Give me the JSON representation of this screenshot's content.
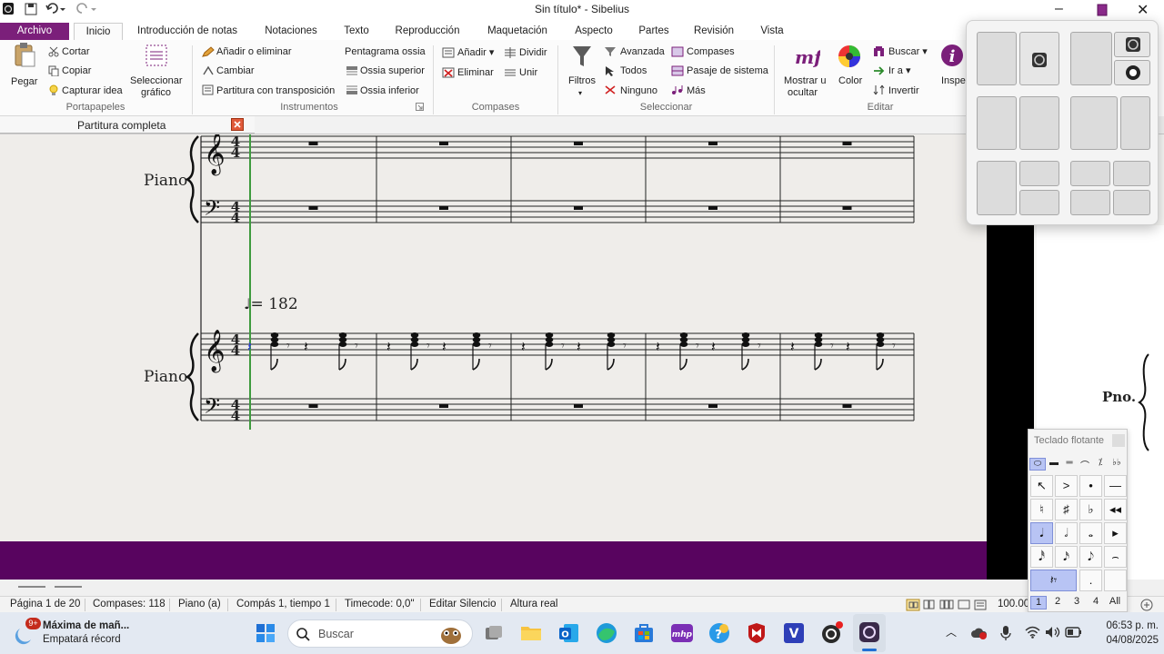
{
  "window": {
    "title": "Sin título* - Sibelius"
  },
  "tabs": [
    {
      "label": "Archivo"
    },
    {
      "label": "Inicio"
    },
    {
      "label": "Introducción de notas"
    },
    {
      "label": "Notaciones"
    },
    {
      "label": "Texto"
    },
    {
      "label": "Reproducción"
    },
    {
      "label": "Maquetación"
    },
    {
      "label": "Aspecto"
    },
    {
      "label": "Partes"
    },
    {
      "label": "Revisión"
    },
    {
      "label": "Vista"
    }
  ],
  "ribbon": {
    "clipboard": {
      "paste": "Pegar",
      "cut": "Cortar",
      "copy": "Copiar",
      "capture": "Capturar idea",
      "select_graphic_1": "Seleccionar",
      "select_graphic_2": "gráfico",
      "group": "Portapapeles"
    },
    "instruments": {
      "add_remove": "Añadir o eliminar",
      "change": "Cambiar",
      "transposing": "Partitura con transposición",
      "ossia_staff": "Pentagrama ossia",
      "ossia_above": "Ossia superior",
      "ossia_below": "Ossia inferior",
      "group": "Instrumentos"
    },
    "bars": {
      "add": "Añadir",
      "split": "Dividir",
      "delete": "Eliminar",
      "join": "Unir",
      "group": "Compases"
    },
    "select": {
      "filters": "Filtros",
      "advanced": "Avanzada",
      "all": "Todos",
      "none": "Ninguno",
      "bars": "Compases",
      "system_passage": "Pasaje de sistema",
      "more": "Más",
      "group": "Seleccionar"
    },
    "edit": {
      "show_hide_1": "Mostrar u",
      "show_hide_2": "ocultar",
      "color": "Color",
      "find": "Buscar",
      "goto": "Ir a",
      "invert": "Invertir",
      "inspector": "Inspec",
      "group": "Editar"
    }
  },
  "document": {
    "tab": "Partitura completa"
  },
  "score": {
    "instrument_1": "Piano",
    "instrument_2": "Piano",
    "instrument_abbrev": "Pno.",
    "time_sig_num": "4",
    "time_sig_den": "4",
    "tempo": "= 182"
  },
  "status": {
    "page": "Página 1 de 20",
    "bars": "Compases: 118",
    "instrument": "Piano (a)",
    "position": "Compás 1, tiempo 1",
    "timecode": "Timecode: 0,0\"",
    "mode": "Editar Silencio",
    "pitch": "Altura real",
    "zoom": "100.00"
  },
  "keypad": {
    "title": "Teclado flotante",
    "layouts": [
      "1",
      "2",
      "3",
      "4",
      "All"
    ]
  },
  "taskbar": {
    "weather_title": "Máxima de mañ...",
    "weather_sub": "Empatará récord",
    "badge": "9+",
    "search": "Buscar",
    "time": "06:53 p. m.",
    "date": "04/08/2025"
  },
  "colors": {
    "purple": "#58045f",
    "file_tab": "#7b1f7a",
    "playline": "#2e8b2e"
  }
}
